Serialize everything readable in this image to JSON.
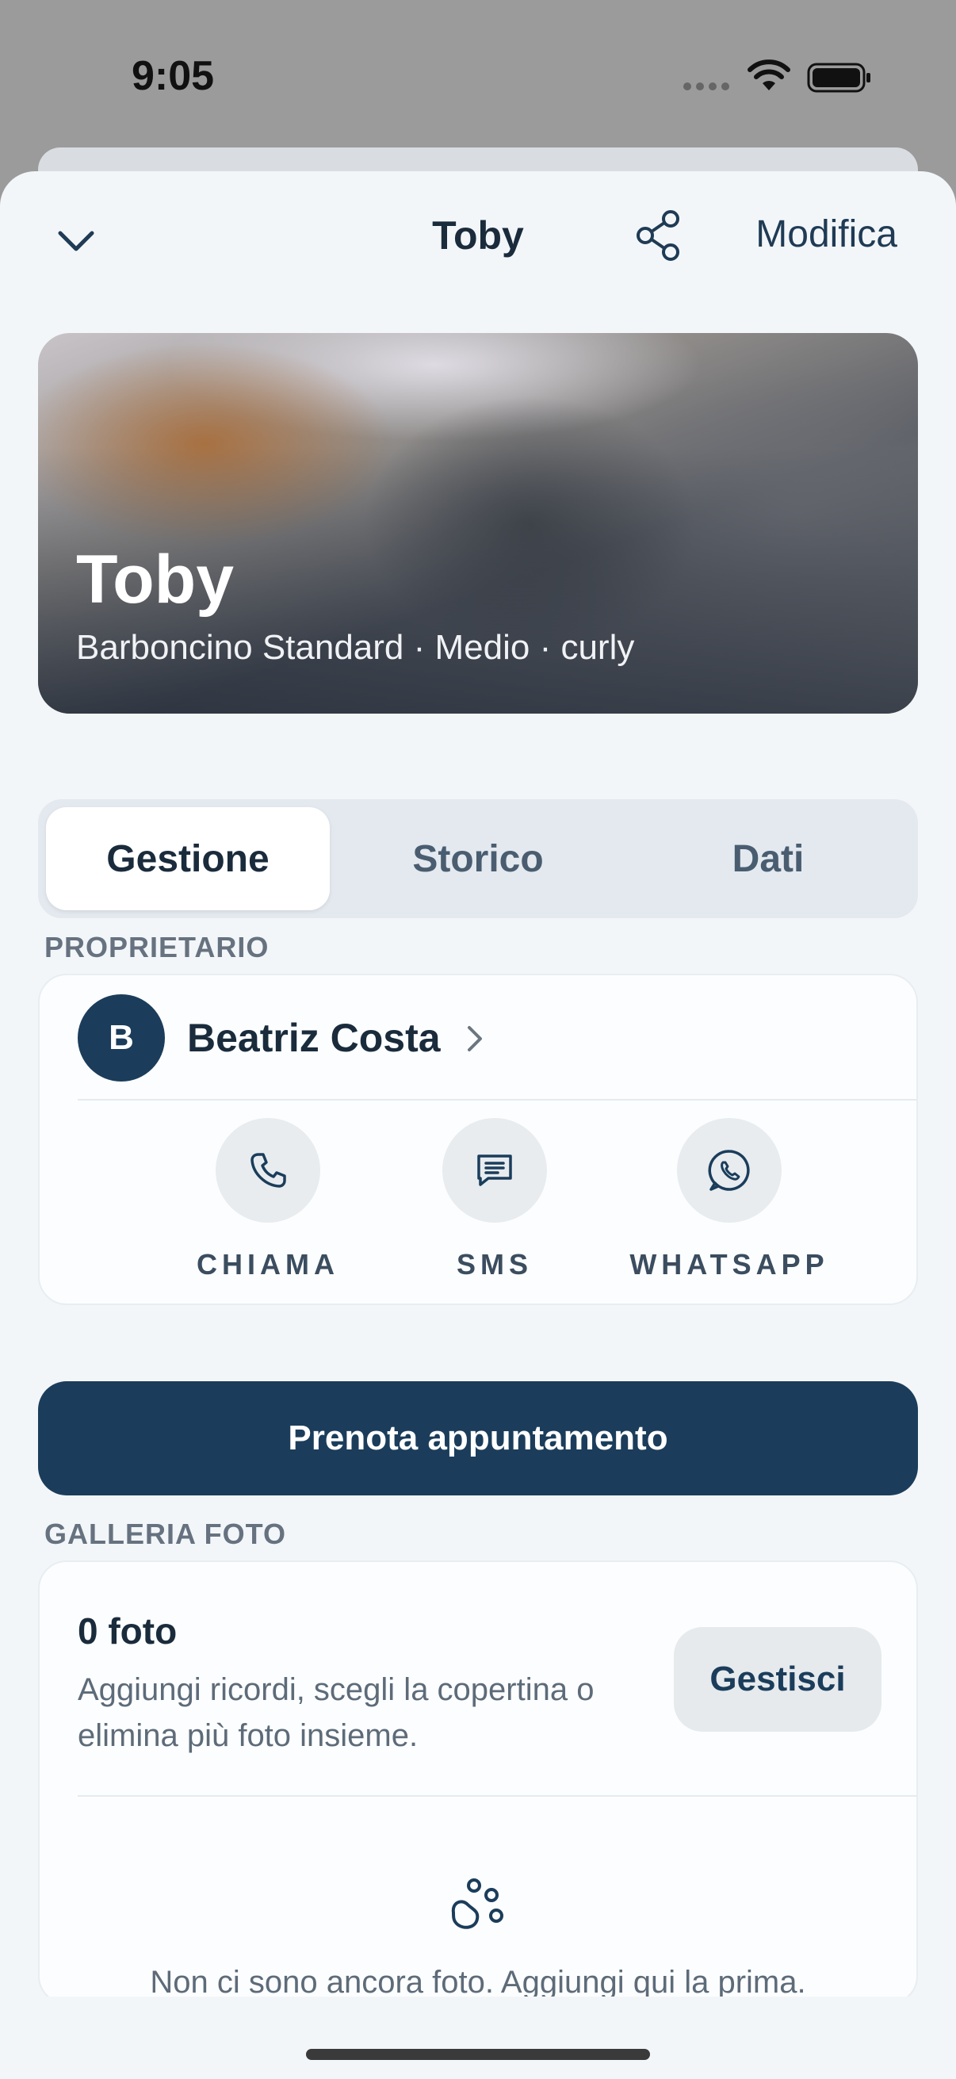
{
  "status_bar": {
    "time": "9:05"
  },
  "nav": {
    "title": "Toby",
    "edit_label": "Modifica"
  },
  "hero": {
    "name": "Toby",
    "subtitle": "Barboncino Standard · Medio · curly"
  },
  "tabs": [
    {
      "label": "Gestione",
      "active": true
    },
    {
      "label": "Storico",
      "active": false
    },
    {
      "label": "Dati",
      "active": false
    }
  ],
  "owner": {
    "section_label": "PROPRIETARIO",
    "initial": "B",
    "name": "Beatriz Costa",
    "actions": [
      {
        "label": "CHIAMA",
        "icon": "phone-icon"
      },
      {
        "label": "SMS",
        "icon": "message-icon"
      },
      {
        "label": "WHATSAPP",
        "icon": "whatsapp-icon"
      }
    ]
  },
  "booking": {
    "label": "Prenota appuntamento"
  },
  "gallery": {
    "section_label": "GALLERIA FOTO",
    "count": "0 foto",
    "description": "Aggiungi ricordi, scegli la copertina o elimina più foto insieme.",
    "manage_label": "Gestisci",
    "empty_text": "Non ci sono ancora foto. Aggiungi qui la prima."
  },
  "colors": {
    "primary": "#1b3d5b",
    "sheet_background": "#f3f6f9",
    "card_background": "#fcfdfe",
    "muted_text": "#5d6b79"
  }
}
